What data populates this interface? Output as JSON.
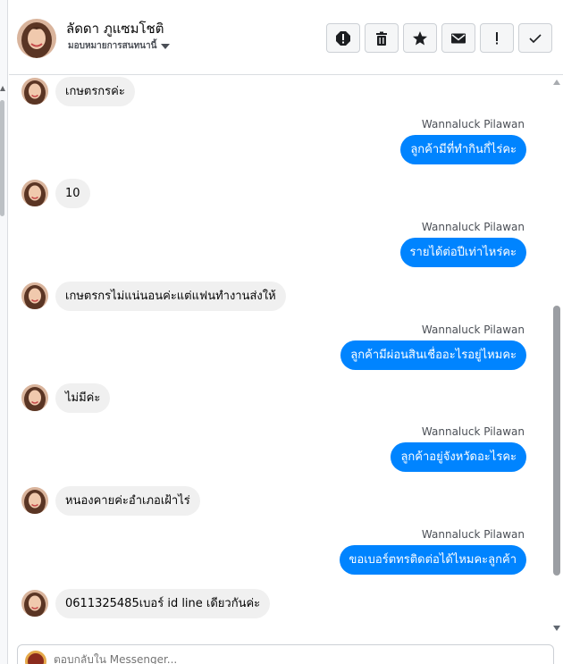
{
  "header": {
    "contact_name": "ลัดดา ภูแซมโชติ",
    "assign_label": "มอบหมายการสนทนานี้",
    "actions": [
      {
        "name": "spam-button",
        "icon": "alert-octagon-icon"
      },
      {
        "name": "delete-button",
        "icon": "trash-icon"
      },
      {
        "name": "star-button",
        "icon": "star-icon"
      },
      {
        "name": "mark-unread-button",
        "icon": "envelope-icon"
      },
      {
        "name": "follow-up-button",
        "icon": "exclamation-icon"
      },
      {
        "name": "mark-done-button",
        "icon": "checkmark-icon"
      }
    ]
  },
  "thread": {
    "messages": [
      {
        "direction": "in",
        "text": "เกษตรกรค่ะ"
      },
      {
        "direction": "out",
        "sender": "Wannaluck Pilawan",
        "text": "ลูกค้ามีที่ทำกินกี่ไร่คะ"
      },
      {
        "direction": "in",
        "text": "10"
      },
      {
        "direction": "out",
        "sender": "Wannaluck Pilawan",
        "text": "รายได้ต่อปีเท่าไหร่คะ"
      },
      {
        "direction": "in",
        "text": "เกษตรกรไม่แน่นอนค่ะแต่แฟนทำงานส่งให้"
      },
      {
        "direction": "out",
        "sender": "Wannaluck Pilawan",
        "text": "ลูกค้ามีผ่อนสินเชื่ออะไรอยู่ไหมคะ"
      },
      {
        "direction": "in",
        "text": "ไม่มีค่ะ"
      },
      {
        "direction": "out",
        "sender": "Wannaluck Pilawan",
        "text": "ลูกค้าอยู่จังหวัดอะไรคะ"
      },
      {
        "direction": "in",
        "text": "หนองคายค่ะอำเภอเฝ้าไร่"
      },
      {
        "direction": "out",
        "sender": "Wannaluck Pilawan",
        "text": "ขอเบอร์ตทรติดต่อได้ไหมคะลูกค้า"
      },
      {
        "direction": "in",
        "text": "0611325485เบอร์ id line เดียวกันค่ะ"
      }
    ]
  },
  "composer": {
    "placeholder": "ตอบกลับใน Messenger..."
  },
  "colors": {
    "outgoing_bubble": "#0084ff",
    "incoming_bubble": "#f0f0f0"
  }
}
